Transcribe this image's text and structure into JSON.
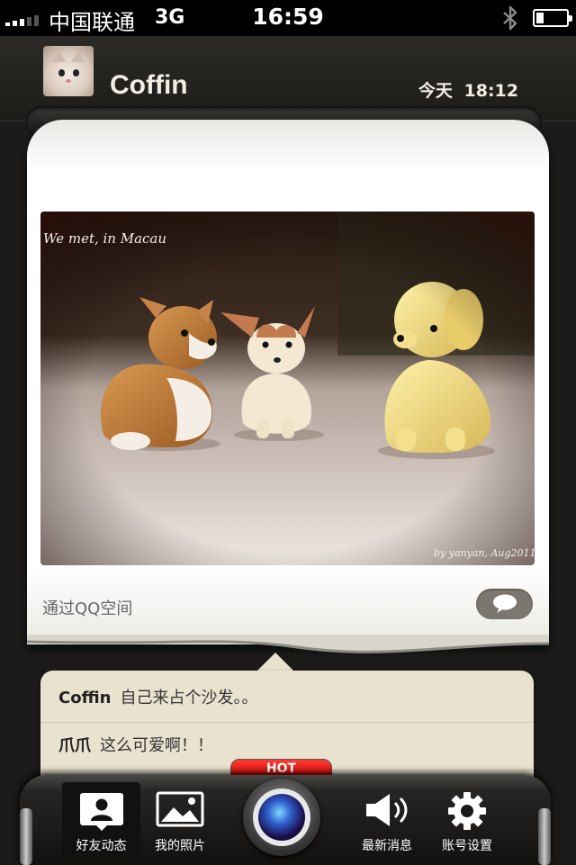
{
  "status_bar": {
    "carrier": "中国联通",
    "network": "3G",
    "time": "16:59",
    "signal_bars": 5,
    "signal_bars_active": 3,
    "battery_level": 0.25,
    "icons": [
      "bluetooth-icon",
      "battery-icon"
    ]
  },
  "post": {
    "user_name": "Coffin",
    "time": "今天 18:12",
    "photo": {
      "caption_top": "We met, in Macau",
      "caption_bottom": "by yanyan, Aug2011"
    },
    "source": "通过QQ空间"
  },
  "comments": [
    {
      "author": "Coffin",
      "text": "自己来占个沙发。。"
    },
    {
      "author": "爪爪",
      "text": "这么可爱啊！！"
    }
  ],
  "tab_bar": {
    "hot_label": "HOT",
    "tabs": [
      {
        "label": "好友动态",
        "icon": "contact-card-icon",
        "active": true
      },
      {
        "label": "我的照片",
        "icon": "photo-icon",
        "active": false
      },
      {
        "label": "",
        "icon": "camera-icon",
        "active": false
      },
      {
        "label": "最新消息",
        "icon": "speaker-icon",
        "active": false
      },
      {
        "label": "账号设置",
        "icon": "gear-icon",
        "active": false
      }
    ]
  },
  "colors": {
    "background": "#1b1a18",
    "card": "#ffffff",
    "comment_panel": "#e9e2cf",
    "hot_badge": "#e00000"
  }
}
